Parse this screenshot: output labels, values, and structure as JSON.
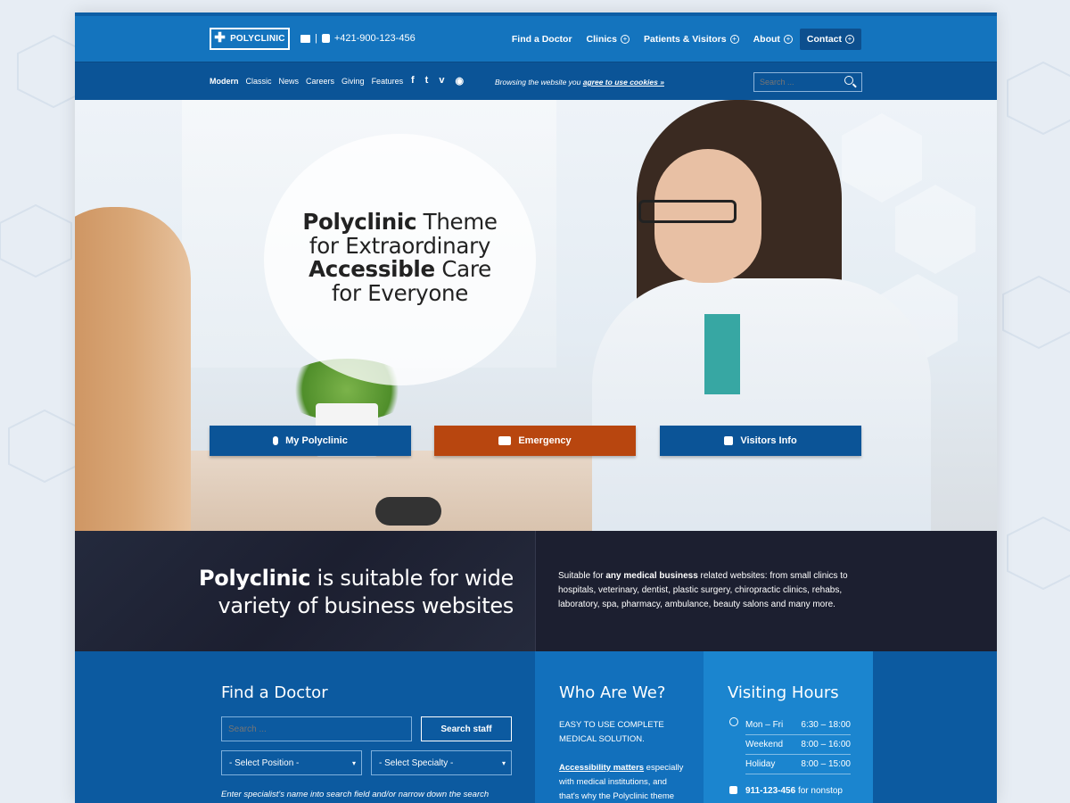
{
  "header": {
    "logo_text": "POLYCLINIC",
    "phone": "+421-900-123-456",
    "nav": [
      {
        "label": "Find a Doctor",
        "has_sub": false
      },
      {
        "label": "Clinics",
        "has_sub": true
      },
      {
        "label": "Patients & Visitors",
        "has_sub": true
      },
      {
        "label": "About",
        "has_sub": true
      },
      {
        "label": "Contact",
        "has_sub": true,
        "active": true
      }
    ]
  },
  "subbar": {
    "links": [
      "Modern",
      "Classic",
      "News",
      "Careers",
      "Giving",
      "Features"
    ],
    "social": [
      "facebook-icon",
      "twitter-icon",
      "vimeo-icon",
      "globe-icon"
    ],
    "cookie_prefix": "Browsing the website you",
    "cookie_link": "agree to use cookies »",
    "search_placeholder": "Search ..."
  },
  "hero": {
    "title_1_bold": "Polyclinic",
    "title_1_rest": " Theme",
    "title_2": "for Extraordinary",
    "title_3_bold": "Accessible",
    "title_3_rest": " Care",
    "title_4": "for Everyone",
    "buttons": [
      {
        "label": "My Polyclinic",
        "color": "#0b5497"
      },
      {
        "label": "Emergency",
        "color": "#b8460f"
      },
      {
        "label": "Visitors Info",
        "color": "#0b5497"
      }
    ]
  },
  "band": {
    "title_bold": "Polyclinic",
    "title_rest_1": " is suitable for wide",
    "title_rest_2": "variety of business websites",
    "text_prefix": "Suitable for ",
    "text_bold": "any medical business",
    "text_rest": " related websites: from small clinics to hospitals, veterinary, dentist, plastic surgery, chiropractic clinics, rehabs, laboratory, spa, pharmacy, ambulance, beauty salons and many more."
  },
  "find_doctor": {
    "heading": "Find a Doctor",
    "search_placeholder": "Search ...",
    "search_button": "Search staff",
    "position_select": "- Select Position -",
    "specialty_select": "- Select Specialty -",
    "note": "Enter specialist's name into search field and/or narrow down the search"
  },
  "who": {
    "heading": "Who Are We?",
    "line1": "EASY TO USE COMPLETE",
    "line2": "MEDICAL SOLUTION.",
    "bold": "Accessibility matters",
    "rest_1": " especially",
    "rest_2": "with medical institutions, and",
    "rest_3": "that's why the Polyclinic theme"
  },
  "hours": {
    "heading": "Visiting Hours",
    "rows": [
      {
        "day": "Mon – Fri",
        "time": "6:30 – 18:00"
      },
      {
        "day": "Weekend",
        "time": "8:00 – 16:00"
      },
      {
        "day": "Holiday",
        "time": "8:00 – 15:00"
      }
    ],
    "phone": "911-123-456",
    "phone_suffix": " for nonstop"
  },
  "colors": {
    "primary": "#1474be",
    "dark_blue": "#0b5497",
    "emergency": "#b8460f",
    "dark_band": "#1c1f30"
  }
}
